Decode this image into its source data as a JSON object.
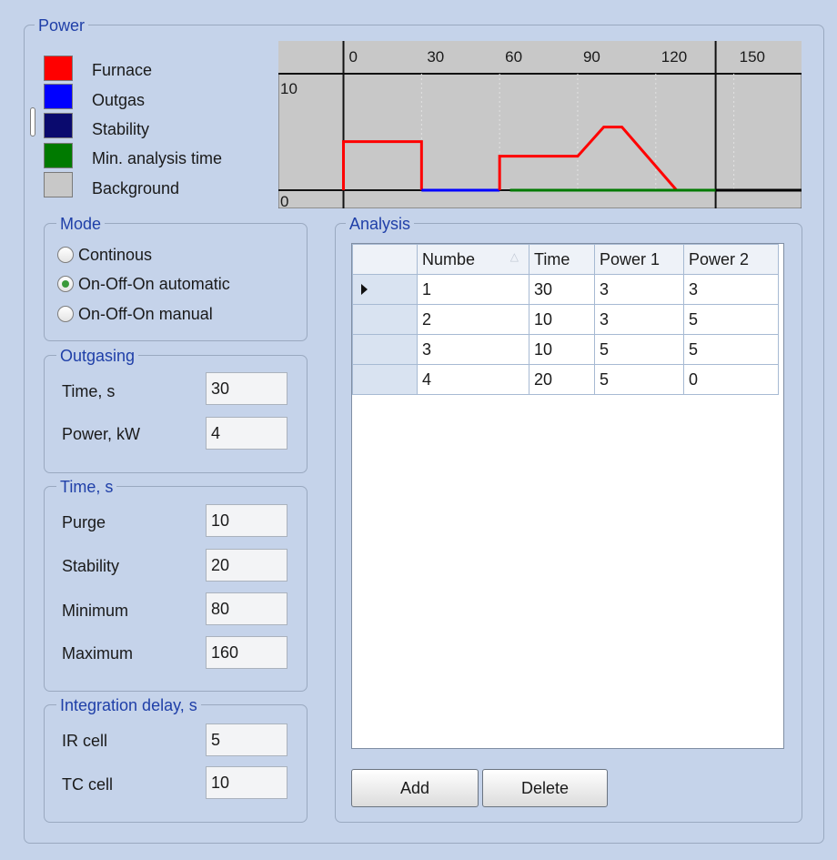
{
  "power": {
    "title": "Power",
    "legend": [
      {
        "label": "Furnace",
        "color": "#ff0000"
      },
      {
        "label": "Outgas",
        "color": "#0000ff"
      },
      {
        "label": "Stability",
        "color": "#0a0a6e"
      },
      {
        "label": "Min. analysis time",
        "color": "#007a00"
      },
      {
        "label": "Background",
        "color": "#c8c8c8"
      }
    ]
  },
  "chart_data": {
    "type": "line",
    "x_ticks": [
      "0",
      "30",
      "60",
      "90",
      "120",
      "150"
    ],
    "y_ticks": [
      "10",
      "0"
    ],
    "xlim": [
      -25,
      176
    ],
    "ylim": [
      0,
      12
    ],
    "markers": [
      0,
      143
    ],
    "series": [
      {
        "color": "#ff0000",
        "x": [
          0,
          0,
          30,
          30
        ],
        "y": [
          0,
          5,
          5,
          0
        ]
      },
      {
        "color": "#0000ff",
        "x": [
          30,
          60
        ],
        "y": [
          0,
          0
        ]
      },
      {
        "color": "#ff0000",
        "x": [
          60,
          60,
          90,
          100,
          107,
          128
        ],
        "y": [
          0,
          3.5,
          3.5,
          6.5,
          6.5,
          0
        ]
      },
      {
        "color": "#007a00",
        "x": [
          64,
          143
        ],
        "y": [
          0,
          0
        ]
      },
      {
        "color": "#000000",
        "x": [
          143,
          176
        ],
        "y": [
          0,
          0
        ]
      }
    ]
  },
  "mode": {
    "title": "Mode",
    "options": [
      {
        "label": "Continous",
        "selected": false
      },
      {
        "label": "On-Off-On automatic",
        "selected": true
      },
      {
        "label": "On-Off-On manual",
        "selected": false
      }
    ]
  },
  "outgasing": {
    "title": "Outgasing",
    "fields": [
      {
        "label": "Time, s",
        "value": "30"
      },
      {
        "label": "Power, kW",
        "value": "4"
      }
    ]
  },
  "time": {
    "title": "Time, s",
    "fields": [
      {
        "label": "Purge",
        "value": "10"
      },
      {
        "label": "Stability",
        "value": "20"
      },
      {
        "label": "Minimum",
        "value": "80"
      },
      {
        "label": "Maximum",
        "value": "160"
      }
    ]
  },
  "integration": {
    "title": "Integration delay, s",
    "fields": [
      {
        "label": "IR cell",
        "value": "5"
      },
      {
        "label": "TC cell",
        "value": "10"
      }
    ]
  },
  "analysis": {
    "title": "Analysis",
    "columns": [
      "Numbe",
      "Time",
      "Power 1",
      "Power 2"
    ],
    "rows": [
      [
        "1",
        "30",
        "3",
        "3"
      ],
      [
        "2",
        "10",
        "3",
        "5"
      ],
      [
        "3",
        "10",
        "5",
        "5"
      ],
      [
        "4",
        "20",
        "5",
        "0"
      ]
    ],
    "add_label": "Add",
    "delete_label": "Delete"
  }
}
